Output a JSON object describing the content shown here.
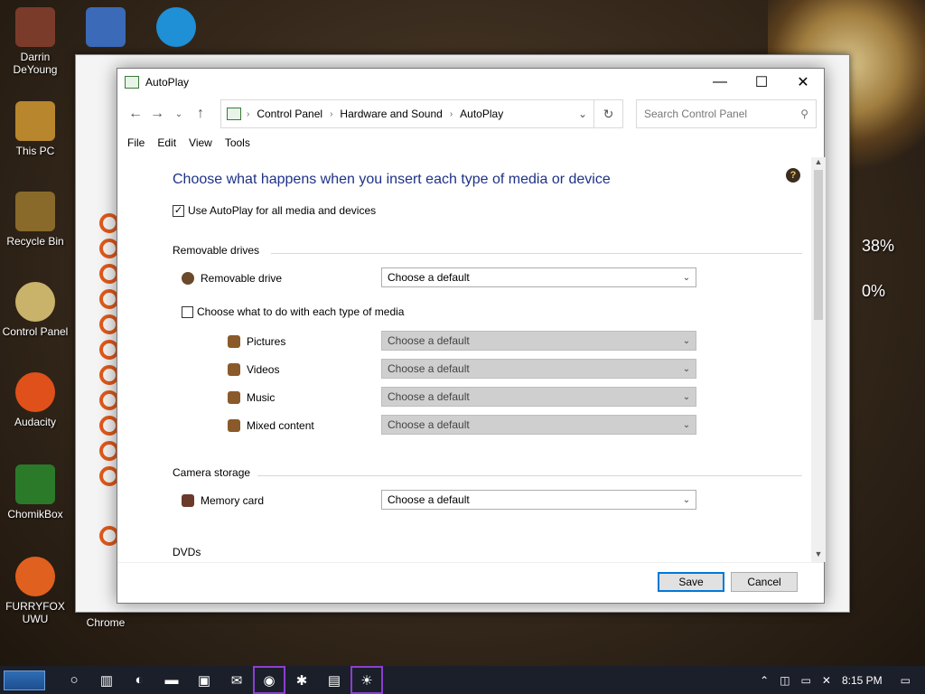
{
  "desktop": {
    "icons": [
      {
        "label": "Darrin DeYoung",
        "color": "#7a3b2a"
      },
      {
        "label": "This PC",
        "color": "#b8862d"
      },
      {
        "label": "Recycle Bin",
        "color": "#8a6a2a"
      },
      {
        "label": "Control Panel",
        "color": "#c9b26a"
      },
      {
        "label": "Audacity",
        "color": "#e0501a"
      },
      {
        "label": "ChomikBox",
        "color": "#2a7a2a"
      },
      {
        "label": "FURRYFOX UWU",
        "color": "#e06020"
      },
      {
        "label": "Chrome",
        "color": "#4a4a4a"
      }
    ],
    "gauge_1": "38%",
    "gauge_2": "0%"
  },
  "window": {
    "title": "AutoPlay",
    "minimize": "—",
    "maximize": "☐",
    "close": "✕"
  },
  "address": {
    "crumbs": [
      "Control Panel",
      "Hardware and Sound",
      "AutoPlay"
    ],
    "search_placeholder": "Search Control Panel"
  },
  "menu": [
    "File",
    "Edit",
    "View",
    "Tools"
  ],
  "content": {
    "heading": "Choose what happens when you insert each type of media or device",
    "use_autoplay": {
      "label": "Use AutoPlay for all media and devices",
      "checked": true
    },
    "removable_drives": {
      "title": "Removable drives",
      "device": "Removable drive",
      "value": "Choose a default"
    },
    "per_media": {
      "label": "Choose what to do with each type of media",
      "checked": false
    },
    "media": [
      {
        "label": "Pictures",
        "value": "Choose a default"
      },
      {
        "label": "Videos",
        "value": "Choose a default"
      },
      {
        "label": "Music",
        "value": "Choose a default"
      },
      {
        "label": "Mixed content",
        "value": "Choose a default"
      }
    ],
    "camera_storage": {
      "title": "Camera storage",
      "device": "Memory card",
      "value": "Choose a default"
    },
    "dvds": {
      "title": "DVDs"
    }
  },
  "footer": {
    "save": "Save",
    "cancel": "Cancel"
  },
  "taskbar": {
    "time": "8:15 PM"
  },
  "colors": {
    "accent": "#0078d7",
    "heading": "#1e3287"
  }
}
